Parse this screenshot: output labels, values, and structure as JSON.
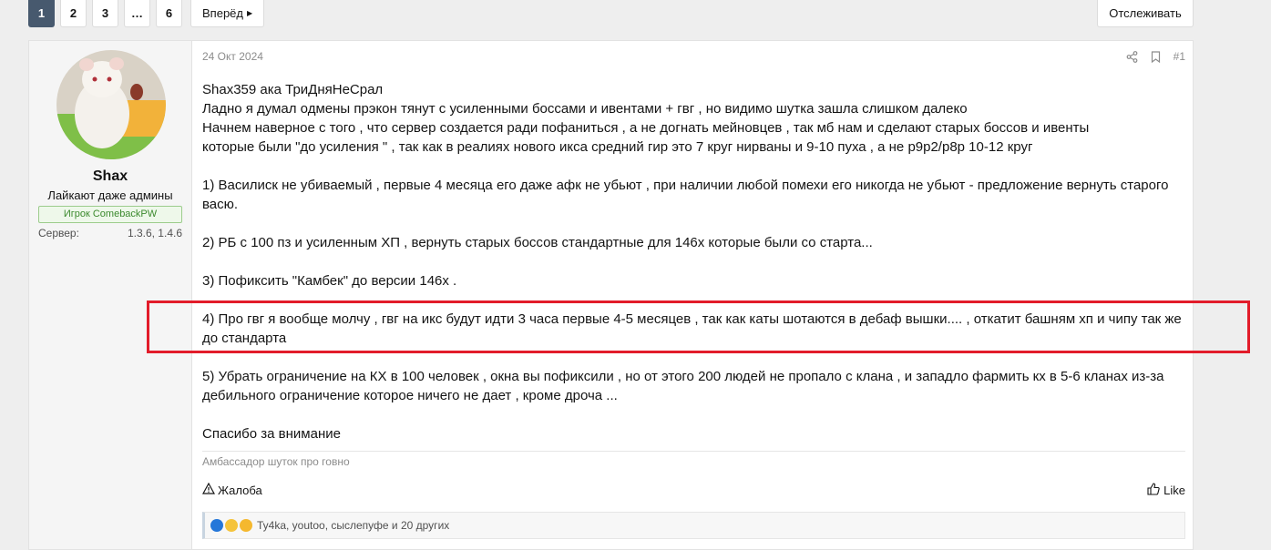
{
  "pagination": {
    "pages": [
      "1",
      "2",
      "3",
      "…",
      "6"
    ],
    "active": "1",
    "next_label": "Вперёд"
  },
  "toolbar": {
    "follow_label": "Отслеживать"
  },
  "user": {
    "name": "Shax",
    "title": "Лайкают даже админы",
    "banner": "Игрок ComebackPW",
    "server_label": "Сервер:",
    "server_value": "1.3.6, 1.4.6"
  },
  "post": {
    "date": "24 Окт 2024",
    "number": "#1",
    "lines": [
      "Shax359 ака ТриДняНеСрал",
      "Ладно я думал одмены прэкон тянут с усиленными боссами и ивентами + гвг , но видимо шутка зашла слишком далеко",
      "Начнем наверное с того , что сервер создается ради пофаниться , а не догнать мейновцев , так мб нам и сделают старых боссов и ивенты",
      "которые были \"до усиления \" , так как в реалиях нового икса средний гир это 7 круг нирваны и 9-10 пуха , а не р9р2/р8р 10-12 круг"
    ],
    "point1": "1) Василиск не убиваемый , первые 4 месяца его даже афк не убьют , при наличии любой помехи его никогда не убьют - предложение вернуть старого васю.",
    "point2": "2) РБ с 100 пз и усиленным ХП , вернуть старых боссов стандартные для 146х которые были со старта...",
    "point3": "3) Пофиксить \"Камбек\" до версии 146х .",
    "point4": "4) Про гвг я вообще молчу , гвг на икс будут идти 3 часа первые 4-5 месяцев , так как каты шотаются в дебаф вышки.... , откатит башням хп и чипу так же до стандарта",
    "point5": "5) Убрать ограничение на КХ в 100 человек , окна вы пофиксили , но от этого 200 людей не пропало с клана , и западло фармить кх в 5-6 кланах из-за дебильного ограничение которое ничего не дает , кроме дроча ...",
    "closing": "Спасибо за внимание",
    "signature": "Амбассадор шуток про говно"
  },
  "actions": {
    "report_label": "Жалоба",
    "like_label": "Like"
  },
  "reactions": {
    "text": "Ty4ka, youtoo, сыслепуфе и 20 других"
  },
  "colors": {
    "active_page": "#47596e",
    "highlight": "#e21c2a",
    "banner_green": "#3c8a2e"
  }
}
